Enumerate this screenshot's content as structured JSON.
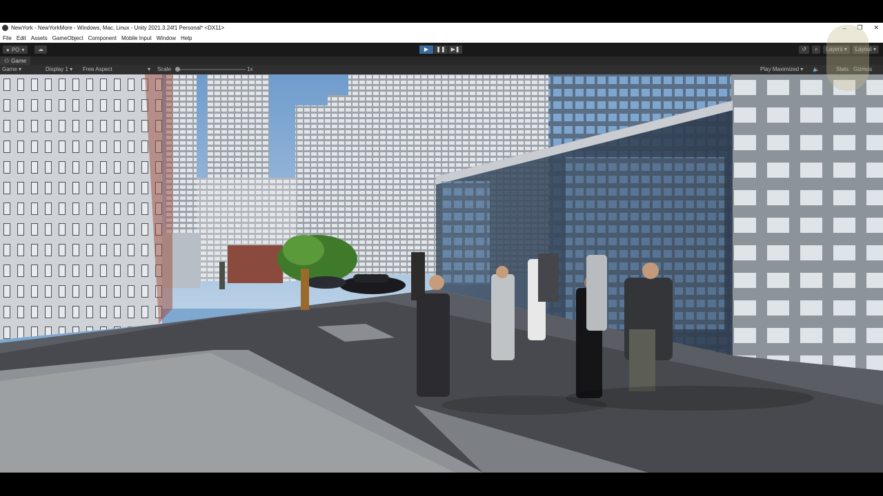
{
  "window": {
    "title": "NewYork - NewYorkMore - Windows, Mac, Linux - Unity 2021.3.24f1 Personal* <DX11>"
  },
  "menu": [
    "File",
    "Edit",
    "Assets",
    "GameObject",
    "Component",
    "Mobile Input",
    "Window",
    "Help"
  ],
  "toolbar": {
    "account_label": "PO",
    "layers_label": "Layers",
    "layout_label": "Layout"
  },
  "game_view": {
    "tab_label": "Game",
    "mode_label": "Game",
    "display_label": "Display 1",
    "aspect_label": "Free Aspect",
    "scale_label": "Scale",
    "scale_value": "1x",
    "play_maximized_label": "Play Maximized",
    "stats_label": "Stats",
    "gizmos_label": "Gizmos"
  },
  "colors": {
    "play_active": "#3d6a9c",
    "toolbar_bg": "#191919",
    "panel_bg": "#2f2f2f"
  }
}
